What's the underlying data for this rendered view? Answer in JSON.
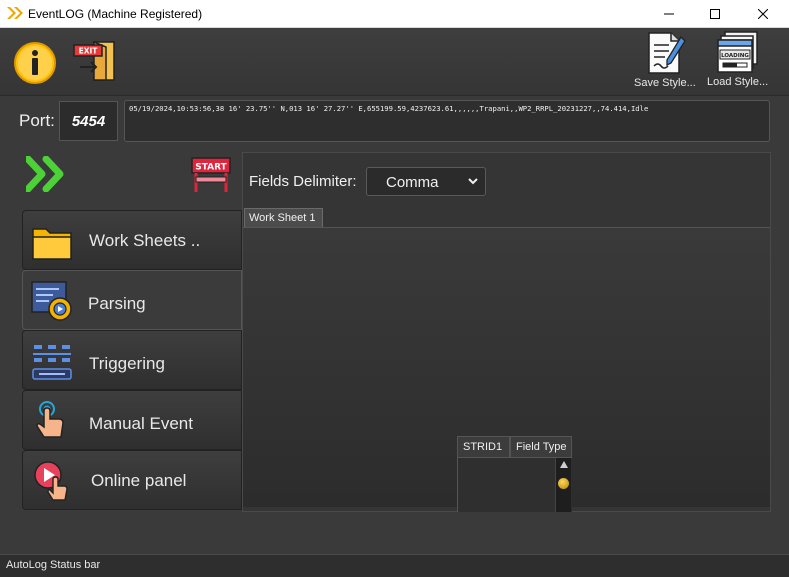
{
  "window": {
    "title": "EventLOG (Machine Registered)"
  },
  "toolbar": {
    "info_icon": "info-icon",
    "exit_icon": "exit-icon",
    "exit_badge": "EXIT",
    "save_style_label": "Save Style...",
    "load_style_label": "Load Style...",
    "loading_badge": "LOADING"
  },
  "port": {
    "label": "Port:",
    "value": "5454"
  },
  "data_line": "05/19/2024,10:53:56,38 16' 23.75'' N,013 16' 27.27'' E,655199.59,4237623.61,,,,,,Trapani,,WP2_RRPL_20231227,,74.414,Idle",
  "start_badge": "START",
  "menu": {
    "items": [
      {
        "label": "Work Sheets ..",
        "icon": "folder-icon"
      },
      {
        "label": "Parsing",
        "icon": "parsing-gear-icon",
        "active": true
      },
      {
        "label": "Triggering",
        "icon": "triggering-icon"
      },
      {
        "label": "Manual Event",
        "icon": "hand-touch-icon"
      },
      {
        "label": "Online panel",
        "icon": "online-play-icon"
      }
    ]
  },
  "parsing": {
    "delimiter_label": "Fields Delimiter:",
    "delimiter_value": "Comma",
    "tabs": [
      "Work Sheet 1"
    ],
    "field_table": {
      "columns": [
        "STRID1",
        "Field Type"
      ]
    }
  },
  "statusbar": {
    "text": "AutoLog Status bar"
  },
  "colors": {
    "background": "#3a3a3a",
    "accent_yellow": "#ffc20e",
    "go_green": "#4cd137",
    "start_red": "#e0243c"
  }
}
